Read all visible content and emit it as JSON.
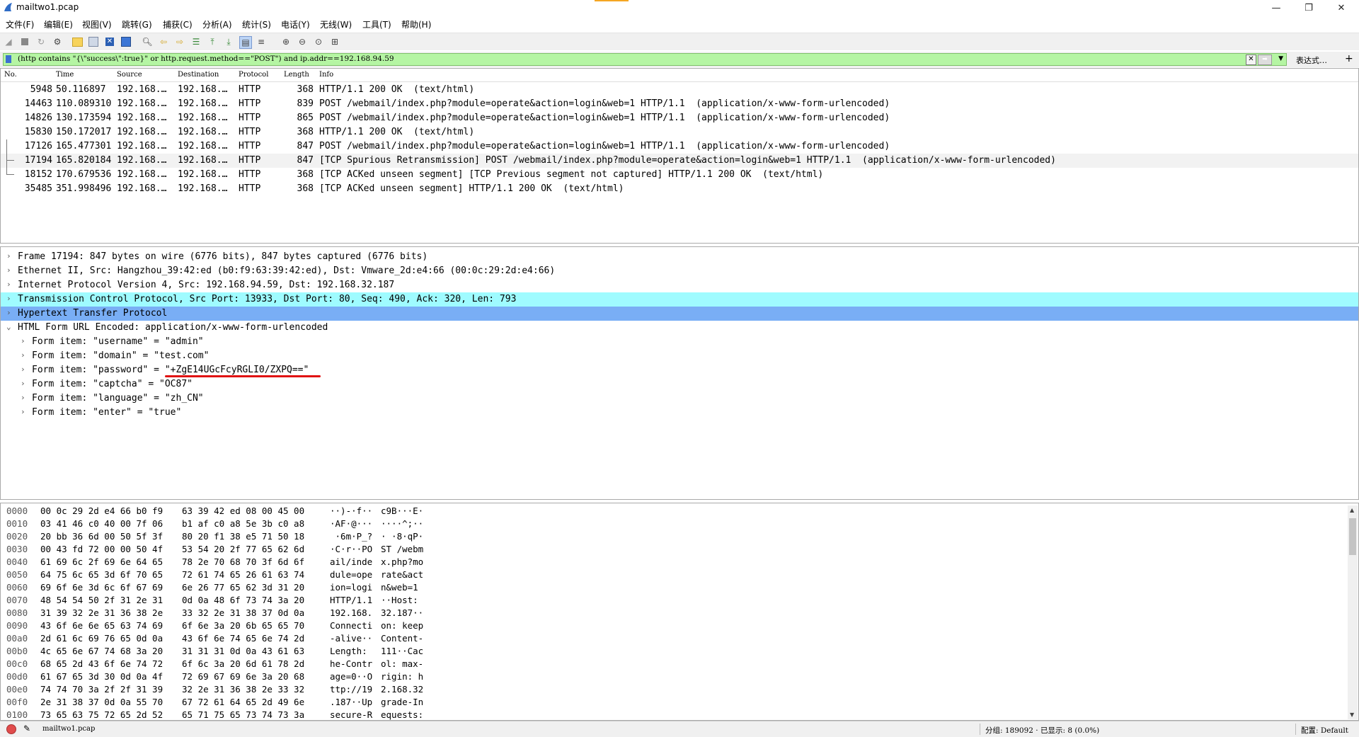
{
  "window": {
    "title": "mailtwo1.pcap",
    "minimize": "—",
    "restore": "❐",
    "close": "✕"
  },
  "menu": [
    "文件(F)",
    "编辑(E)",
    "视图(V)",
    "跳转(G)",
    "捕获(C)",
    "分析(A)",
    "统计(S)",
    "电话(Y)",
    "无线(W)",
    "工具(T)",
    "帮助(H)"
  ],
  "filter": {
    "value": "(http contains \"{\\\"success\\\":true}\" or http.request.method==\"POST\") and ip.addr==192.168.94.59",
    "expression_label": "表达式…",
    "plus": "+",
    "bg_color": "#b5f5a3"
  },
  "packet_list": {
    "headers": [
      "No.",
      "Time",
      "Source",
      "Destination",
      "Protocol",
      "Length",
      "Info"
    ],
    "rows": [
      {
        "no": "5948",
        "time": "50.116897",
        "src": "192.168.…",
        "dst": "192.168.…",
        "proto": "HTTP",
        "len": "368",
        "info": "HTTP/1.1 200 OK  (text/html)"
      },
      {
        "no": "14463",
        "time": "110.089310",
        "src": "192.168.…",
        "dst": "192.168.…",
        "proto": "HTTP",
        "len": "839",
        "info": "POST /webmail/index.php?module=operate&action=login&web=1 HTTP/1.1  (application/x-www-form-urlencoded)"
      },
      {
        "no": "14826",
        "time": "130.173594",
        "src": "192.168.…",
        "dst": "192.168.…",
        "proto": "HTTP",
        "len": "865",
        "info": "POST /webmail/index.php?module=operate&action=login&web=1 HTTP/1.1  (application/x-www-form-urlencoded)"
      },
      {
        "no": "15830",
        "time": "150.172017",
        "src": "192.168.…",
        "dst": "192.168.…",
        "proto": "HTTP",
        "len": "368",
        "info": "HTTP/1.1 200 OK  (text/html)"
      },
      {
        "no": "17126",
        "time": "165.477301",
        "src": "192.168.…",
        "dst": "192.168.…",
        "proto": "HTTP",
        "len": "847",
        "info": "POST /webmail/index.php?module=operate&action=login&web=1 HTTP/1.1  (application/x-www-form-urlencoded)"
      },
      {
        "no": "17194",
        "time": "165.820184",
        "src": "192.168.…",
        "dst": "192.168.…",
        "proto": "HTTP",
        "len": "847",
        "info": "[TCP Spurious Retransmission] POST /webmail/index.php?module=operate&action=login&web=1 HTTP/1.1  (application/x-www-form-urlencoded)"
      },
      {
        "no": "18152",
        "time": "170.679536",
        "src": "192.168.…",
        "dst": "192.168.…",
        "proto": "HTTP",
        "len": "368",
        "info": "[TCP ACKed unseen segment] [TCP Previous segment not captured] HTTP/1.1 200 OK  (text/html)"
      },
      {
        "no": "35485",
        "time": "351.998496",
        "src": "192.168.…",
        "dst": "192.168.…",
        "proto": "HTTP",
        "len": "368",
        "info": "[TCP ACKed unseen segment] HTTP/1.1 200 OK  (text/html)"
      }
    ]
  },
  "details": {
    "rows": [
      {
        "text": "Frame 17194: 847 bytes on wire (6776 bits), 847 bytes captured (6776 bits)",
        "arrow": "›"
      },
      {
        "text": "Ethernet II, Src: Hangzhou_39:42:ed (b0:f9:63:39:42:ed), Dst: Vmware_2d:e4:66 (00:0c:29:2d:e4:66)",
        "arrow": "›"
      },
      {
        "text": "Internet Protocol Version 4, Src: 192.168.94.59, Dst: 192.168.32.187",
        "arrow": "›"
      },
      {
        "text": "Transmission Control Protocol, Src Port: 13933, Dst Port: 80, Seq: 490, Ack: 320, Len: 793",
        "arrow": "›"
      },
      {
        "text": "Hypertext Transfer Protocol",
        "arrow": "›"
      },
      {
        "text": "HTML Form URL Encoded: application/x-www-form-urlencoded",
        "arrow": "⌄"
      },
      {
        "text": "Form item: \"username\" = \"admin\"",
        "arrow": "›"
      },
      {
        "text": "Form item: \"domain\" = \"test.com\"",
        "arrow": "›"
      },
      {
        "text": "Form item: \"password\" = \"+ZgE14UGcFcyRGLI0/ZXPQ==\"",
        "arrow": "›"
      },
      {
        "text": "Form item: \"captcha\" = \"OC87\"",
        "arrow": "›"
      },
      {
        "text": "Form item: \"language\" = \"zh_CN\"",
        "arrow": "›"
      },
      {
        "text": "Form item: \"enter\" = \"true\"",
        "arrow": "›"
      }
    ]
  },
  "bytes": {
    "rows": [
      {
        "off": "0000",
        "hex1": "00 0c 29 2d e4 66 b0 f9",
        "hex2": "63 39 42 ed 08 00 45 00",
        "a1": "··)-·f··",
        "a2": "c9B···E·"
      },
      {
        "off": "0010",
        "hex1": "03 41 46 c0 40 00 7f 06",
        "hex2": "b1 af c0 a8 5e 3b c0 a8",
        "a1": "·AF·@···",
        "a2": "····^;··"
      },
      {
        "off": "0020",
        "hex1": "20 bb 36 6d 00 50 5f 3f",
        "hex2": "80 20 f1 38 e5 71 50 18",
        "a1": " ·6m·P_?",
        "a2": "· ·8·qP·"
      },
      {
        "off": "0030",
        "hex1": "00 43 fd 72 00 00 50 4f",
        "hex2": "53 54 20 2f 77 65 62 6d",
        "a1": "·C·r··PO",
        "a2": "ST /webm"
      },
      {
        "off": "0040",
        "hex1": "61 69 6c 2f 69 6e 64 65",
        "hex2": "78 2e 70 68 70 3f 6d 6f",
        "a1": "ail/inde",
        "a2": "x.php?mo"
      },
      {
        "off": "0050",
        "hex1": "64 75 6c 65 3d 6f 70 65",
        "hex2": "72 61 74 65 26 61 63 74",
        "a1": "dule=ope",
        "a2": "rate&act"
      },
      {
        "off": "0060",
        "hex1": "69 6f 6e 3d 6c 6f 67 69",
        "hex2": "6e 26 77 65 62 3d 31 20",
        "a1": "ion=logi",
        "a2": "n&web=1 "
      },
      {
        "off": "0070",
        "hex1": "48 54 54 50 2f 31 2e 31",
        "hex2": "0d 0a 48 6f 73 74 3a 20",
        "a1": "HTTP/1.1",
        "a2": "··Host: "
      },
      {
        "off": "0080",
        "hex1": "31 39 32 2e 31 36 38 2e",
        "hex2": "33 32 2e 31 38 37 0d 0a",
        "a1": "192.168.",
        "a2": "32.187··"
      },
      {
        "off": "0090",
        "hex1": "43 6f 6e 6e 65 63 74 69",
        "hex2": "6f 6e 3a 20 6b 65 65 70",
        "a1": "Connecti",
        "a2": "on: keep"
      },
      {
        "off": "00a0",
        "hex1": "2d 61 6c 69 76 65 0d 0a",
        "hex2": "43 6f 6e 74 65 6e 74 2d",
        "a1": "-alive··",
        "a2": "Content-"
      },
      {
        "off": "00b0",
        "hex1": "4c 65 6e 67 74 68 3a 20",
        "hex2": "31 31 31 0d 0a 43 61 63",
        "a1": "Length: ",
        "a2": "111··Cac"
      },
      {
        "off": "00c0",
        "hex1": "68 65 2d 43 6f 6e 74 72",
        "hex2": "6f 6c 3a 20 6d 61 78 2d",
        "a1": "he-Contr",
        "a2": "ol: max-"
      },
      {
        "off": "00d0",
        "hex1": "61 67 65 3d 30 0d 0a 4f",
        "hex2": "72 69 67 69 6e 3a 20 68",
        "a1": "age=0··O",
        "a2": "rigin: h"
      },
      {
        "off": "00e0",
        "hex1": "74 74 70 3a 2f 2f 31 39",
        "hex2": "32 2e 31 36 38 2e 33 32",
        "a1": "ttp://19",
        "a2": "2.168.32"
      },
      {
        "off": "00f0",
        "hex1": "2e 31 38 37 0d 0a 55 70",
        "hex2": "67 72 61 64 65 2d 49 6e",
        "a1": ".187··Up",
        "a2": "grade-In"
      },
      {
        "off": "0100",
        "hex1": "73 65 63 75 72 65 2d 52",
        "hex2": "65 71 75 65 73 74 73 3a",
        "a1": "secure-R",
        "a2": "equests:"
      }
    ]
  },
  "status": {
    "file": "mailtwo1.pcap",
    "stats": "分组: 189092 · 已显示: 8 (0.0%)",
    "profile": "配置: Default"
  }
}
